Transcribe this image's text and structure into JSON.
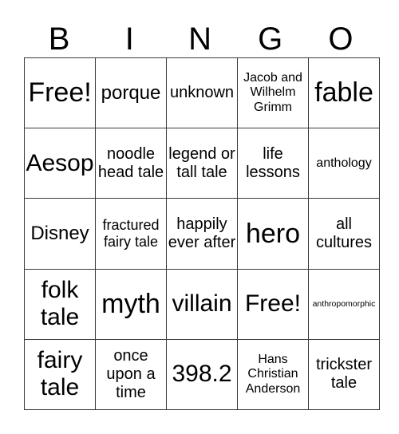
{
  "header": [
    "B",
    "I",
    "N",
    "G",
    "O"
  ],
  "rows": [
    [
      {
        "text": "Free!",
        "size": "s36"
      },
      {
        "text": "porque",
        "size": "s24"
      },
      {
        "text": "unknown",
        "size": "s20"
      },
      {
        "text": "Jacob and Wilhelm Grimm",
        "size": "s16"
      },
      {
        "text": "fable",
        "size": "s36"
      }
    ],
    [
      {
        "text": "Aesop",
        "size": "s30"
      },
      {
        "text": "noodle head tale",
        "size": "s20"
      },
      {
        "text": "legend or tall tale",
        "size": "s20"
      },
      {
        "text": "life lessons",
        "size": "s20"
      },
      {
        "text": "anthology",
        "size": "s16"
      }
    ],
    [
      {
        "text": "Disney",
        "size": "s24"
      },
      {
        "text": "fractured fairy tale",
        "size": "s18"
      },
      {
        "text": "happily ever after",
        "size": "s20"
      },
      {
        "text": "hero",
        "size": "s36"
      },
      {
        "text": "all cultures",
        "size": "s20"
      }
    ],
    [
      {
        "text": "folk tale",
        "size": "s30"
      },
      {
        "text": "myth",
        "size": "s36"
      },
      {
        "text": "villain",
        "size": "s30"
      },
      {
        "text": "Free!",
        "size": "s30"
      },
      {
        "text": "anthropomorphic",
        "size": "s11"
      }
    ],
    [
      {
        "text": "fairy tale",
        "size": "s30"
      },
      {
        "text": "once upon a time",
        "size": "s20"
      },
      {
        "text": "398.2",
        "size": "s30"
      },
      {
        "text": "Hans Christian Anderson",
        "size": "s16"
      },
      {
        "text": "trickster tale",
        "size": "s20"
      }
    ]
  ]
}
